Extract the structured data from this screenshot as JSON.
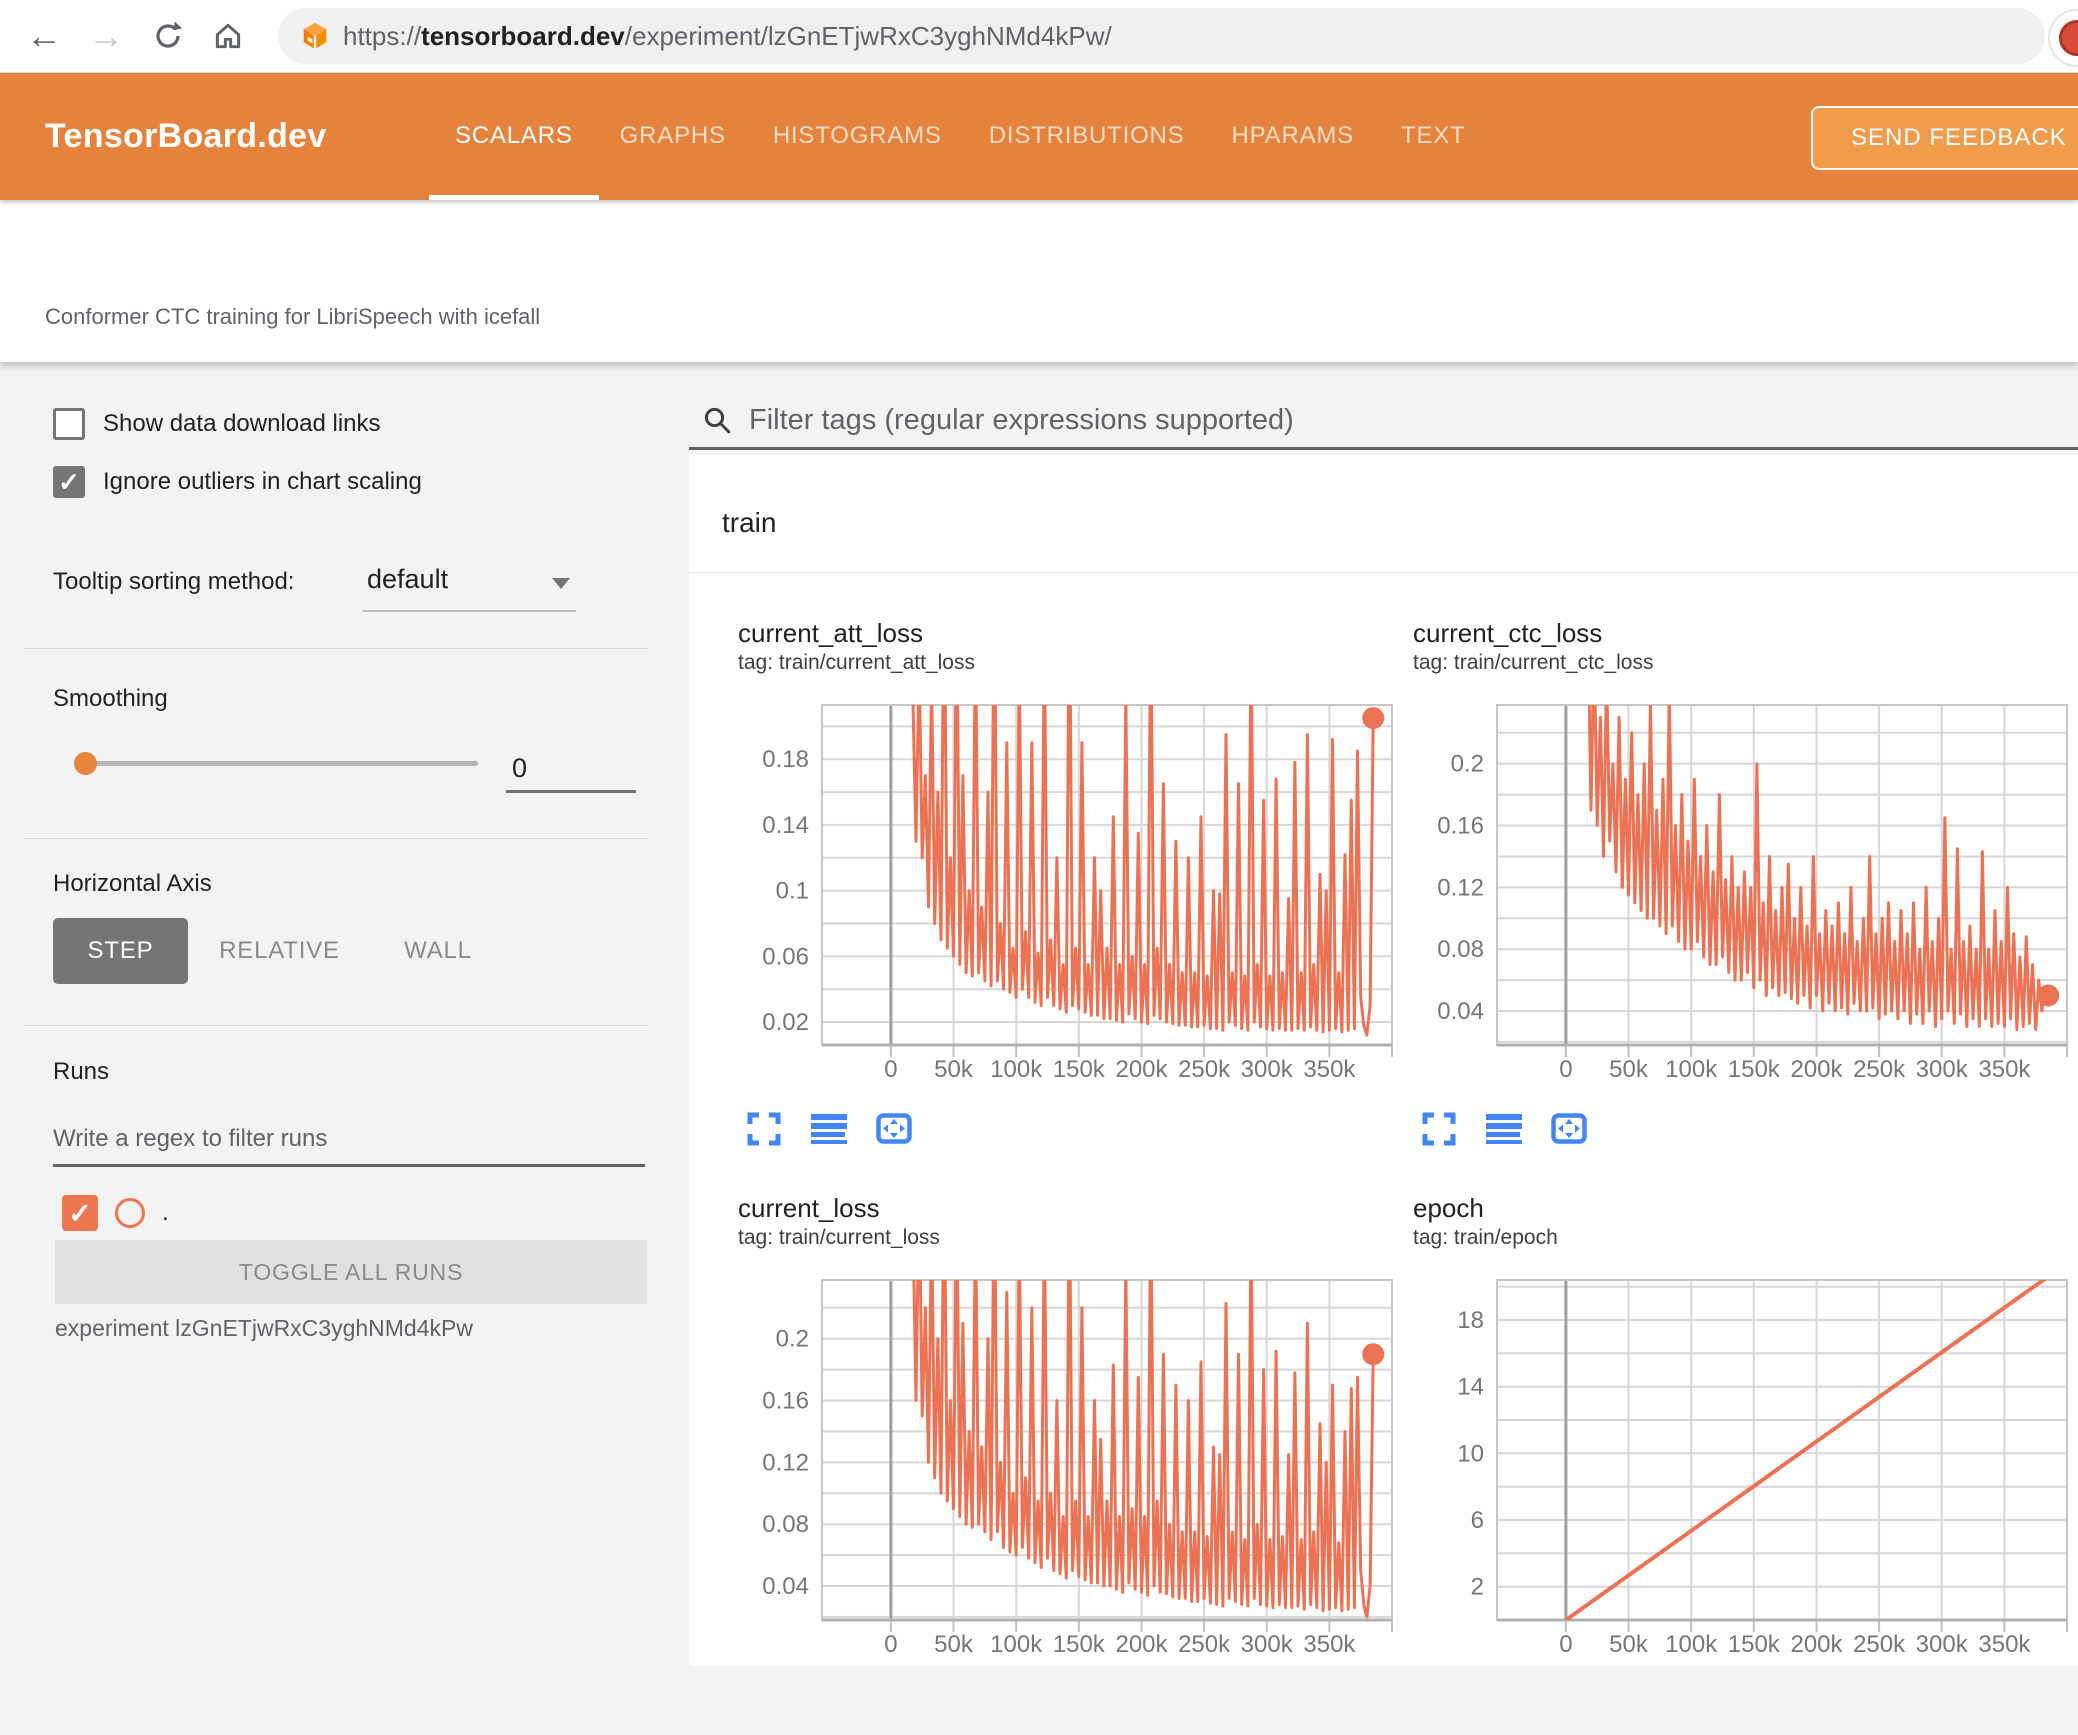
{
  "colors": {
    "header_orange": "#e5833c",
    "feedback_orange": "#f09c4b",
    "run_orange": "#ee7752",
    "line_orange": "#ec7254",
    "icon_blue": "#4285f4"
  },
  "browser": {
    "url_prefix": "https://",
    "url_domain": "tensorboard.dev",
    "url_path": "/experiment/lzGnETjwRxC3yghNMd4kPw/"
  },
  "header": {
    "logo": "TensorBoard.dev",
    "tabs": [
      {
        "label": "SCALARS",
        "active": true
      },
      {
        "label": "GRAPHS",
        "active": false
      },
      {
        "label": "HISTOGRAMS",
        "active": false
      },
      {
        "label": "DISTRIBUTIONS",
        "active": false
      },
      {
        "label": "HPARAMS",
        "active": false
      },
      {
        "label": "TEXT",
        "active": false
      }
    ],
    "feedback_label": "SEND FEEDBACK"
  },
  "experiment": {
    "title": "Conformer CTC training for LibriSpeech with icefall",
    "id_line": "experiment lzGnETjwRxC3yghNMd4kPw"
  },
  "sidebar": {
    "show_download": {
      "label": "Show data download links",
      "checked": false
    },
    "ignore_outliers": {
      "label": "Ignore outliers in chart scaling",
      "checked": true,
      "check_glyph": "✓"
    },
    "tooltip_sorting": {
      "label": "Tooltip sorting method:",
      "value": "default"
    },
    "smoothing": {
      "label": "Smoothing",
      "value": "0"
    },
    "horizontal_axis": {
      "label": "Horizontal Axis",
      "options": [
        "STEP",
        "RELATIVE",
        "WALL"
      ],
      "selected": "STEP"
    },
    "runs": {
      "label": "Runs",
      "filter_placeholder": "Write a regex to filter runs",
      "run_name": ".",
      "run_checked": true,
      "check_glyph": "✓",
      "toggle_label": "TOGGLE ALL RUNS"
    }
  },
  "main": {
    "filter_placeholder": "Filter tags (regular expressions supported)",
    "section_title": "train"
  },
  "chart_data": [
    {
      "type": "line",
      "title": "current_att_loss",
      "tag": "tag: train/current_att_loss",
      "color": "#ec7254",
      "stroke_w": 3,
      "end_dot": true,
      "xlim_k": [
        -55,
        400
      ],
      "x_tick_step_k": 50,
      "x_grid_max_k": 400,
      "x_tick_labels": [
        "0",
        "50k",
        "100k",
        "150k",
        "200k",
        "250k",
        "300k",
        "350k"
      ],
      "ylim": [
        0.006,
        0.213
      ],
      "y_grid_step": 0.02,
      "y_tick_values": [
        0.02,
        0.06,
        0.1,
        0.14,
        0.18
      ],
      "y_tick_labels": [
        "0.02",
        "0.06",
        "0.1",
        "0.14",
        "0.18"
      ],
      "series": {
        "x_start_k": 12.5,
        "x_step_k": 2.5,
        "y_values": [
          0.5,
          0.35,
          0.22,
          0.13,
          0.24,
          0.12,
          0.17,
          0.09,
          0.23,
          0.08,
          0.16,
          0.07,
          0.3,
          0.065,
          0.12,
          0.06,
          0.28,
          0.055,
          0.17,
          0.05,
          0.1,
          0.048,
          0.26,
          0.05,
          0.09,
          0.045,
          0.16,
          0.042,
          0.3,
          0.045,
          0.08,
          0.04,
          0.19,
          0.038,
          0.065,
          0.035,
          0.24,
          0.04,
          0.075,
          0.035,
          0.19,
          0.032,
          0.062,
          0.03,
          0.26,
          0.035,
          0.07,
          0.03,
          0.12,
          0.028,
          0.055,
          0.026,
          0.3,
          0.03,
          0.065,
          0.028,
          0.19,
          0.026,
          0.055,
          0.024,
          0.12,
          0.024,
          0.1,
          0.022,
          0.065,
          0.022,
          0.145,
          0.021,
          0.055,
          0.02,
          0.22,
          0.025,
          0.06,
          0.022,
          0.135,
          0.02,
          0.055,
          0.019,
          0.28,
          0.024,
          0.065,
          0.022,
          0.165,
          0.02,
          0.055,
          0.019,
          0.13,
          0.018,
          0.05,
          0.018,
          0.12,
          0.017,
          0.05,
          0.017,
          0.145,
          0.018,
          0.048,
          0.016,
          0.1,
          0.016,
          0.098,
          0.015,
          0.195,
          0.02,
          0.05,
          0.018,
          0.165,
          0.016,
          0.048,
          0.015,
          0.26,
          0.02,
          0.055,
          0.017,
          0.155,
          0.016,
          0.048,
          0.015,
          0.168,
          0.016,
          0.05,
          0.015,
          0.095,
          0.015,
          0.178,
          0.016,
          0.05,
          0.015,
          0.195,
          0.017,
          0.055,
          0.015,
          0.11,
          0.014,
          0.1,
          0.015,
          0.192,
          0.016,
          0.05,
          0.014,
          0.122,
          0.015,
          0.155,
          0.016,
          0.185,
          0.035,
          0.018,
          0.012,
          0.03,
          0.205
        ]
      }
    },
    {
      "type": "line",
      "title": "current_ctc_loss",
      "tag": "tag: train/current_ctc_loss",
      "color": "#ec7254",
      "stroke_w": 3,
      "end_dot": true,
      "xlim_k": [
        -55,
        400
      ],
      "x_tick_step_k": 50,
      "x_grid_max_k": 400,
      "x_tick_labels": [
        "0",
        "50k",
        "100k",
        "150k",
        "200k",
        "250k",
        "300k",
        "350k"
      ],
      "ylim": [
        0.018,
        0.238
      ],
      "y_grid_step": 0.02,
      "y_tick_values": [
        0.04,
        0.08,
        0.12,
        0.16,
        0.2
      ],
      "y_tick_labels": [
        "0.04",
        "0.08",
        "0.12",
        "0.16",
        "0.2"
      ],
      "series": {
        "x_start_k": 12.5,
        "x_step_k": 2.5,
        "y_values": [
          0.5,
          0.4,
          0.3,
          0.17,
          0.28,
          0.16,
          0.23,
          0.14,
          0.26,
          0.15,
          0.2,
          0.13,
          0.23,
          0.12,
          0.19,
          0.115,
          0.22,
          0.11,
          0.18,
          0.105,
          0.2,
          0.1,
          0.24,
          0.1,
          0.17,
          0.095,
          0.19,
          0.09,
          0.25,
          0.095,
          0.16,
          0.085,
          0.18,
          0.08,
          0.15,
          0.08,
          0.19,
          0.085,
          0.14,
          0.075,
          0.16,
          0.07,
          0.13,
          0.07,
          0.18,
          0.075,
          0.125,
          0.065,
          0.14,
          0.06,
          0.12,
          0.06,
          0.13,
          0.065,
          0.12,
          0.055,
          0.2,
          0.06,
          0.11,
          0.05,
          0.14,
          0.055,
          0.105,
          0.05,
          0.12,
          0.052,
          0.135,
          0.048,
          0.1,
          0.045,
          0.12,
          0.05,
          0.095,
          0.042,
          0.14,
          0.05,
          0.09,
          0.04,
          0.105,
          0.045,
          0.095,
          0.04,
          0.11,
          0.042,
          0.09,
          0.038,
          0.12,
          0.045,
          0.085,
          0.04,
          0.1,
          0.04,
          0.14,
          0.042,
          0.09,
          0.035,
          0.1,
          0.038,
          0.11,
          0.04,
          0.085,
          0.035,
          0.105,
          0.04,
          0.09,
          0.032,
          0.11,
          0.038,
          0.08,
          0.032,
          0.12,
          0.04,
          0.085,
          0.03,
          0.1,
          0.035,
          0.165,
          0.04,
          0.08,
          0.032,
          0.145,
          0.038,
          0.085,
          0.03,
          0.095,
          0.035,
          0.08,
          0.03,
          0.143,
          0.035,
          0.08,
          0.03,
          0.105,
          0.032,
          0.085,
          0.03,
          0.12,
          0.035,
          0.09,
          0.028,
          0.075,
          0.03,
          0.088,
          0.032,
          0.07,
          0.028,
          0.06,
          0.04,
          0.055,
          0.05
        ]
      }
    },
    {
      "type": "line",
      "title": "current_loss",
      "tag": "tag: train/current_loss",
      "color": "#ec7254",
      "stroke_w": 3,
      "end_dot": true,
      "xlim_k": [
        -55,
        400
      ],
      "x_tick_step_k": 50,
      "x_grid_max_k": 400,
      "x_tick_labels": [
        "0",
        "50k",
        "100k",
        "150k",
        "200k",
        "250k",
        "300k",
        "350k"
      ],
      "ylim": [
        0.018,
        0.238
      ],
      "y_grid_step": 0.02,
      "y_tick_values": [
        0.04,
        0.08,
        0.12,
        0.16,
        0.2
      ],
      "y_tick_labels": [
        "0.04",
        "0.08",
        "0.12",
        "0.16",
        "0.2"
      ],
      "series": {
        "x_start_k": 12.5,
        "x_step_k": 2.5,
        "y_values": [
          0.5,
          0.4,
          0.28,
          0.16,
          0.3,
          0.15,
          0.22,
          0.12,
          0.28,
          0.11,
          0.2,
          0.1,
          0.32,
          0.095,
          0.16,
          0.09,
          0.3,
          0.085,
          0.21,
          0.08,
          0.14,
          0.078,
          0.28,
          0.08,
          0.13,
          0.075,
          0.2,
          0.07,
          0.32,
          0.075,
          0.12,
          0.065,
          0.23,
          0.062,
          0.1,
          0.06,
          0.27,
          0.065,
          0.11,
          0.058,
          0.22,
          0.055,
          0.095,
          0.052,
          0.28,
          0.058,
          0.1,
          0.05,
          0.16,
          0.048,
          0.085,
          0.045,
          0.31,
          0.05,
          0.095,
          0.046,
          0.22,
          0.044,
          0.085,
          0.042,
          0.16,
          0.042,
          0.135,
          0.04,
          0.095,
          0.04,
          0.183,
          0.038,
          0.085,
          0.036,
          0.25,
          0.042,
          0.09,
          0.038,
          0.175,
          0.036,
          0.085,
          0.034,
          0.3,
          0.04,
          0.095,
          0.036,
          0.19,
          0.035,
          0.08,
          0.033,
          0.17,
          0.032,
          0.075,
          0.032,
          0.16,
          0.03,
          0.075,
          0.03,
          0.185,
          0.032,
          0.072,
          0.029,
          0.13,
          0.028,
          0.125,
          0.027,
          0.223,
          0.032,
          0.075,
          0.03,
          0.19,
          0.028,
          0.07,
          0.027,
          0.28,
          0.032,
          0.08,
          0.028,
          0.18,
          0.027,
          0.07,
          0.026,
          0.192,
          0.028,
          0.072,
          0.026,
          0.125,
          0.026,
          0.178,
          0.027,
          0.07,
          0.025,
          0.21,
          0.028,
          0.075,
          0.026,
          0.145,
          0.024,
          0.12,
          0.025,
          0.17,
          0.026,
          0.068,
          0.024,
          0.14,
          0.025,
          0.168,
          0.026,
          0.175,
          0.05,
          0.028,
          0.02,
          0.04,
          0.19
        ]
      }
    },
    {
      "type": "line",
      "title": "epoch",
      "tag": "tag: train/epoch",
      "color": "#ec7254",
      "stroke_w": 4,
      "end_dot": false,
      "xlim_k": [
        -55,
        400
      ],
      "x_tick_step_k": 50,
      "x_grid_max_k": 400,
      "x_tick_labels": [
        "0",
        "50k",
        "100k",
        "150k",
        "200k",
        "250k",
        "300k",
        "350k"
      ],
      "ylim": [
        0,
        20.4
      ],
      "y_grid_step": 2,
      "y_tick_values": [
        2,
        6,
        10,
        14,
        18
      ],
      "y_tick_labels": [
        "2",
        "6",
        "10",
        "14",
        "18"
      ],
      "series": {
        "points_k": [
          [
            0,
            0
          ],
          [
            383,
            20.5
          ]
        ]
      }
    }
  ]
}
